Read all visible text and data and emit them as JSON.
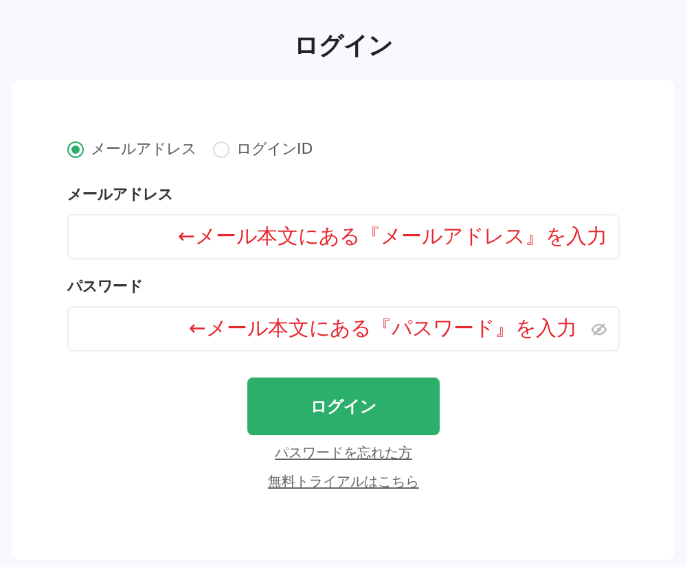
{
  "title": "ログイン",
  "login_type": [
    {
      "label": "メールアドレス",
      "selected": true
    },
    {
      "label": "ログインID",
      "selected": false
    }
  ],
  "fields": [
    {
      "kind": "text",
      "label": "メールアドレス",
      "annotation": "←メール本文にある『メールアドレス』を入力"
    },
    {
      "kind": "password",
      "label": "パスワード",
      "annotation": "←メール本文にある『パスワード』を入力"
    }
  ],
  "submit": "ログイン",
  "links": [
    "パスワードを忘れた方",
    "無料トライアルはこちら"
  ]
}
